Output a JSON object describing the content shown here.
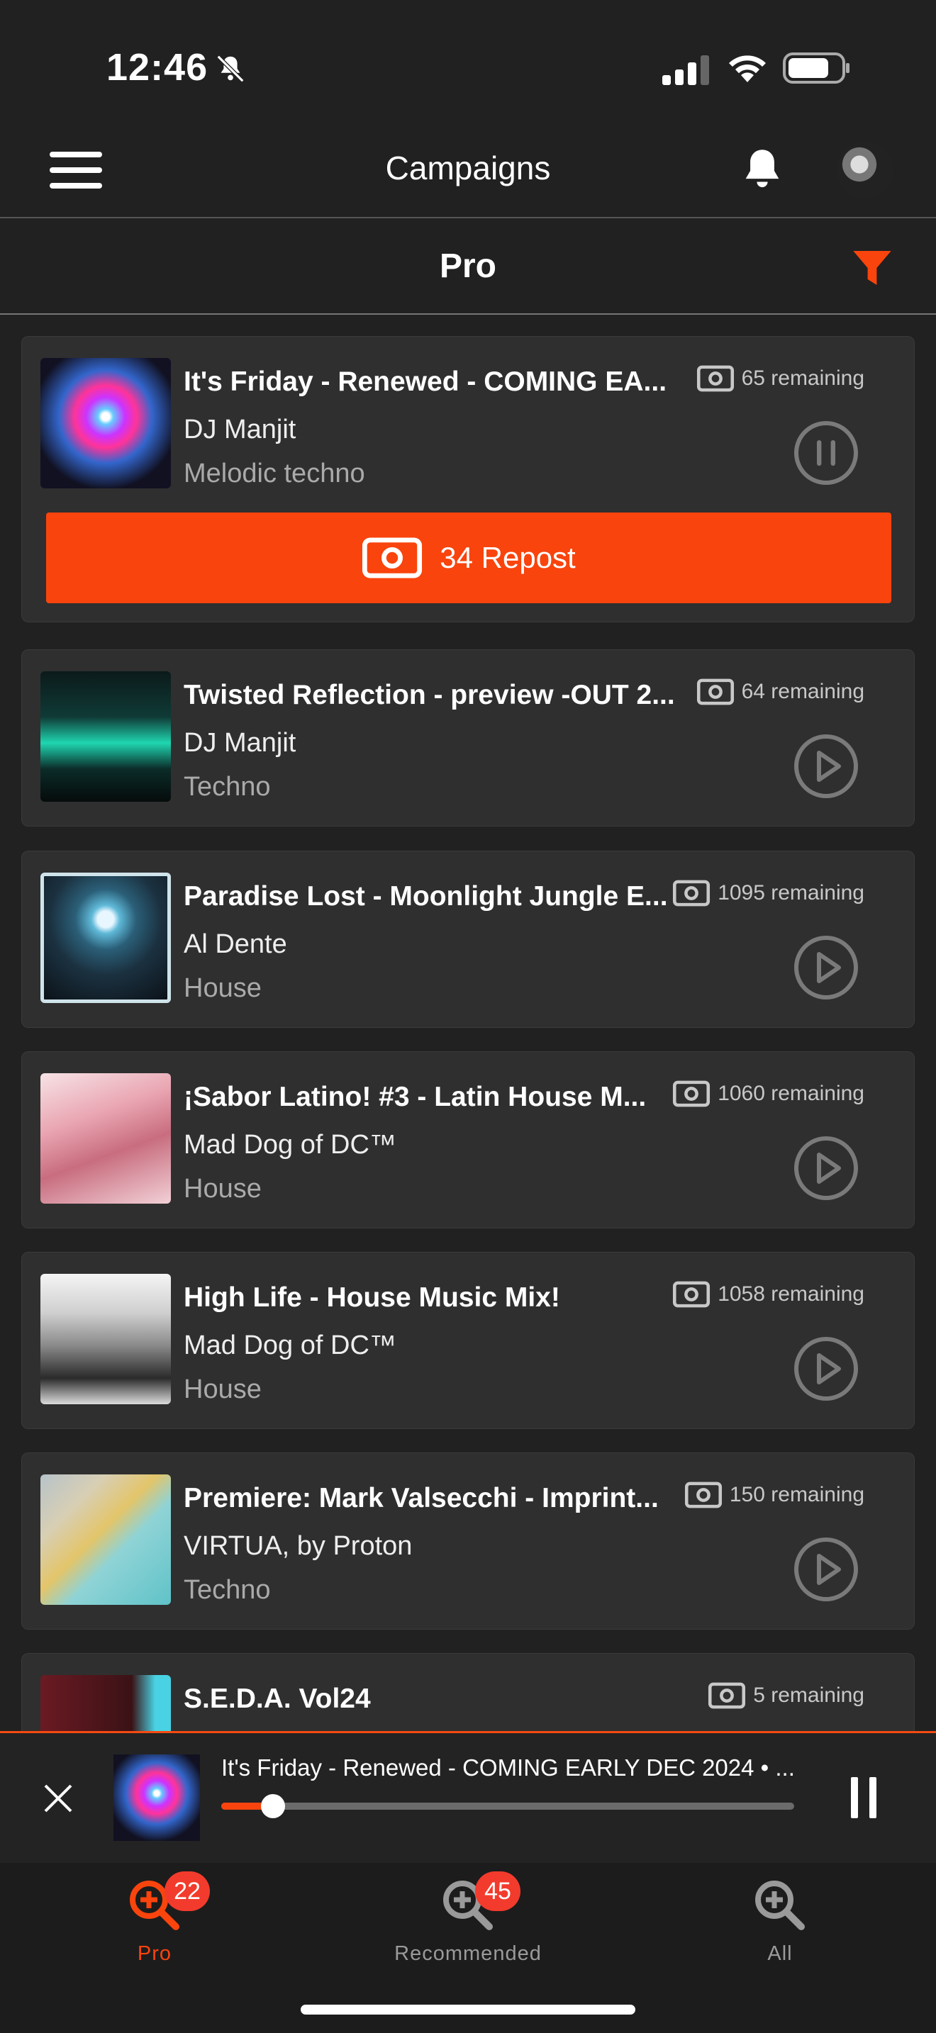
{
  "status_bar": {
    "time": "12:46"
  },
  "header": {
    "title": "Campaigns"
  },
  "subheader": {
    "title": "Pro"
  },
  "campaigns": [
    {
      "title": "It's Friday - Renewed - COMING EA...",
      "artist": "DJ Manjit",
      "genre": "Melodic techno",
      "remaining": "65 remaining",
      "state": "playing",
      "repost_label": "34 Repost",
      "cover": "cover-neon-tree"
    },
    {
      "title": "Twisted Reflection - preview -OUT 2...",
      "artist": "DJ Manjit",
      "genre": "Techno",
      "remaining": "64 remaining",
      "state": "paused",
      "cover": "cover-green-pyramid"
    },
    {
      "title": "Paradise Lost - Moonlight Jungle E...",
      "artist": "Al Dente",
      "genre": "House",
      "remaining": "1095 remaining",
      "state": "paused",
      "cover": "cover-paradise-lost"
    },
    {
      "title": "¡Sabor Latino! #3 - Latin House M...",
      "artist": "Mad Dog of DC™",
      "genre": "House",
      "remaining": "1060 remaining",
      "state": "paused",
      "cover": "cover-sabor-latino"
    },
    {
      "title": "High Life - House Music Mix!",
      "artist": "Mad Dog of DC™",
      "genre": "House",
      "remaining": "1058 remaining",
      "state": "paused",
      "cover": "cover-high-life"
    },
    {
      "title": "Premiere: Mark Valsecchi - Imprint...",
      "artist": "VIRTUA, by Proton",
      "genre": "Techno",
      "remaining": "150 remaining",
      "state": "paused",
      "cover": "cover-imprint"
    },
    {
      "title": "S.E.D.A. Vol24",
      "artist": "",
      "genre": "",
      "remaining": "5 remaining",
      "state": "paused",
      "cover": "cover-seda"
    }
  ],
  "player": {
    "title": "It's Friday - Renewed - COMING EARLY DEC 2024  • ...",
    "progress": 0.09
  },
  "tabs": [
    {
      "label": "Pro",
      "badge": "22",
      "active": true
    },
    {
      "label": "Recommended",
      "badge": "45",
      "active": false
    },
    {
      "label": "All",
      "badge": "",
      "active": false
    }
  ],
  "colors": {
    "accent": "#f9440d",
    "background": "#212121",
    "card": "#2f2f2f",
    "badge": "#f23b2c"
  }
}
